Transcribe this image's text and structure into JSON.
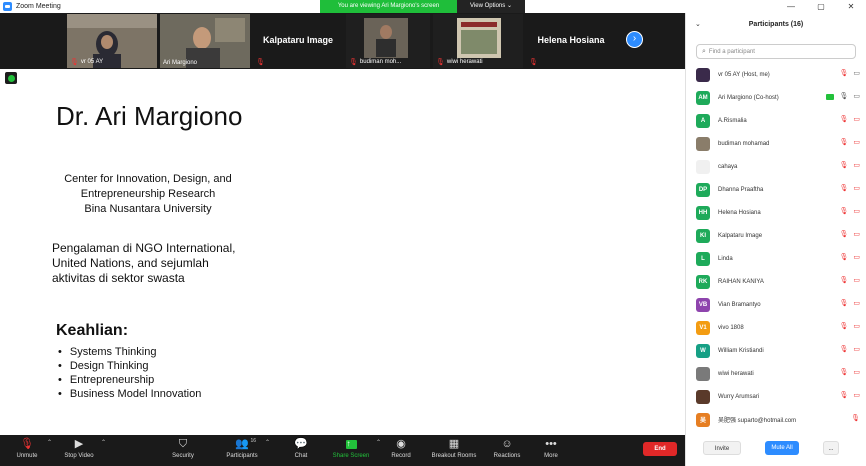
{
  "window": {
    "title": "Zoom Meeting",
    "controls": [
      "—",
      "▢",
      "✕"
    ]
  },
  "banner": {
    "message": "You are viewing Ari Margiono's screen",
    "options_label": "View Options ⌄"
  },
  "video_strip": {
    "tiles": [
      {
        "name": "vr 05 AY",
        "type": "video"
      },
      {
        "name": "Ari Margiono",
        "type": "video",
        "active": true
      },
      {
        "name": "Kalpataru Image",
        "type": "name"
      },
      {
        "name": "budiman moh...",
        "type": "video"
      },
      {
        "name": "wiwi herawati",
        "type": "video"
      },
      {
        "name": "Helena Hosiana",
        "type": "name"
      }
    ]
  },
  "slide": {
    "title": "Dr. Ari Margiono",
    "affiliation": [
      "Center for Innovation, Design, and",
      "Entrepreneurship Research",
      "Bina Nusantara University"
    ],
    "experience": [
      "Pengalaman di NGO International,",
      "United Nations, and sejumlah",
      "aktivitas di sektor swasta"
    ],
    "skills_heading": "Keahlian:",
    "skills": [
      "Systems Thinking",
      "Design Thinking",
      "Entrepreneurship",
      "Business Model Innovation"
    ]
  },
  "toolbar": {
    "unmute": "Unmute",
    "stop_video": "Stop Video",
    "security": "Security",
    "participants": "Participants",
    "participants_count": "16",
    "chat": "Chat",
    "share_screen": "Share Screen",
    "record": "Record",
    "breakout_rooms": "Breakout Rooms",
    "reactions": "Reactions",
    "more": "More",
    "end": "End"
  },
  "participants_panel": {
    "title": "Participants (16)",
    "search_placeholder": "Find a participant",
    "participants": [
      {
        "name": "vr 05 AY (Host, me)",
        "initials": "",
        "color": "#3a2a4a",
        "mic": "off",
        "video": "on"
      },
      {
        "name": "Ari Margiono (Co-host)",
        "initials": "AM",
        "color": "#1eaa5a",
        "mic": "on",
        "video": "on",
        "sharing": true
      },
      {
        "name": "A.Rismalia",
        "initials": "A",
        "color": "#1eaa5a",
        "mic": "off",
        "video": "off"
      },
      {
        "name": "budiman mohamad",
        "initials": "",
        "color": "#8a7d6a",
        "mic": "off",
        "video": "off"
      },
      {
        "name": "cahaya",
        "initials": "",
        "color": "#f0f0f0",
        "mic": "off",
        "video": "off"
      },
      {
        "name": "Dhanna Praaftha",
        "initials": "DP",
        "color": "#1eaa5a",
        "mic": "off",
        "video": "off"
      },
      {
        "name": "Helena Hosiana",
        "initials": "HH",
        "color": "#1eaa5a",
        "mic": "off",
        "video": "off"
      },
      {
        "name": "Kalpataru Image",
        "initials": "KI",
        "color": "#1eaa5a",
        "mic": "off",
        "video": "off"
      },
      {
        "name": "Linda",
        "initials": "L",
        "color": "#1eaa5a",
        "mic": "off",
        "video": "off"
      },
      {
        "name": "RAIHAN KANIYA",
        "initials": "RK",
        "color": "#1eaa5a",
        "mic": "off",
        "video": "off"
      },
      {
        "name": "Vian Bramantyo",
        "initials": "VB",
        "color": "#8e44ad",
        "mic": "off",
        "video": "off"
      },
      {
        "name": "vivo 1808",
        "initials": "V1",
        "color": "#f39c12",
        "mic": "off",
        "video": "off"
      },
      {
        "name": "William Kristiandi",
        "initials": "W",
        "color": "#16a085",
        "mic": "off",
        "video": "off"
      },
      {
        "name": "wiwi herawati",
        "initials": "",
        "color": "#7a7a7a",
        "mic": "off",
        "video": "off"
      },
      {
        "name": "Wurry Arumsari",
        "initials": "",
        "color": "#5a3a2a",
        "mic": "off",
        "video": "off"
      },
      {
        "name": "吴肥强 suparto@hotmail.com",
        "initials": "吴",
        "color": "#e67e22",
        "mic": "off",
        "video": "none"
      }
    ],
    "invite": "Invite",
    "mute_all": "Mute All",
    "more": "..."
  }
}
